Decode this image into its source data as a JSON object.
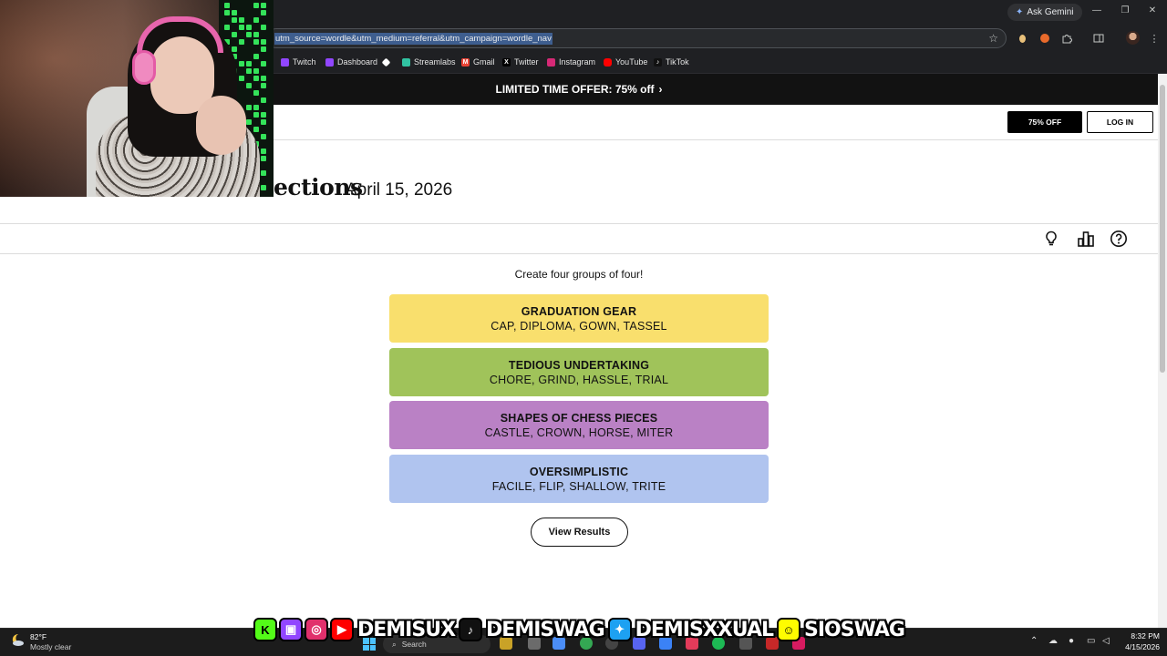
{
  "browser": {
    "gemini_label": "Ask Gemini",
    "url_fragment": "utm_source=wordle&utm_medium=referral&utm_campaign=wordle_nav",
    "bookmarks": [
      "Twitch",
      "Dashboard",
      "Streamlabs",
      "Gmail",
      "Twitter",
      "Instagram",
      "YouTube",
      "TikTok"
    ]
  },
  "page": {
    "promo_text": "LIMITED TIME OFFER: 75% off",
    "offer_button": "75% OFF",
    "login_button": "LOG IN",
    "game_title_visible": "ections",
    "game_date": "April 15, 2026",
    "instruction": "Create four groups of four!",
    "groups": [
      {
        "title": "GRADUATION GEAR",
        "words": "CAP, DIPLOMA, GOWN, TASSEL",
        "color": "#f9df6d"
      },
      {
        "title": "TEDIOUS UNDERTAKING",
        "words": "CHORE, GRIND, HASSLE, TRIAL",
        "color": "#a0c35a"
      },
      {
        "title": "SHAPES OF CHESS PIECES",
        "words": "CASTLE, CROWN, HORSE, MITER",
        "color": "#ba81c5"
      },
      {
        "title": "OVERSIMPLISTIC",
        "words": "FACILE, FLIP, SHALLOW, TRITE",
        "color": "#b0c4ef"
      }
    ],
    "view_results": "View Results"
  },
  "stream_banner": {
    "handles": [
      "DEMISUX",
      "DEMISWAG",
      "DEMISXXUAL",
      "SIOSWAG"
    ]
  },
  "taskbar": {
    "weather_temp": "82°F",
    "weather_desc": "Mostly clear",
    "search_placeholder": "Search",
    "time": "8:32 PM",
    "date": "4/15/2026"
  }
}
